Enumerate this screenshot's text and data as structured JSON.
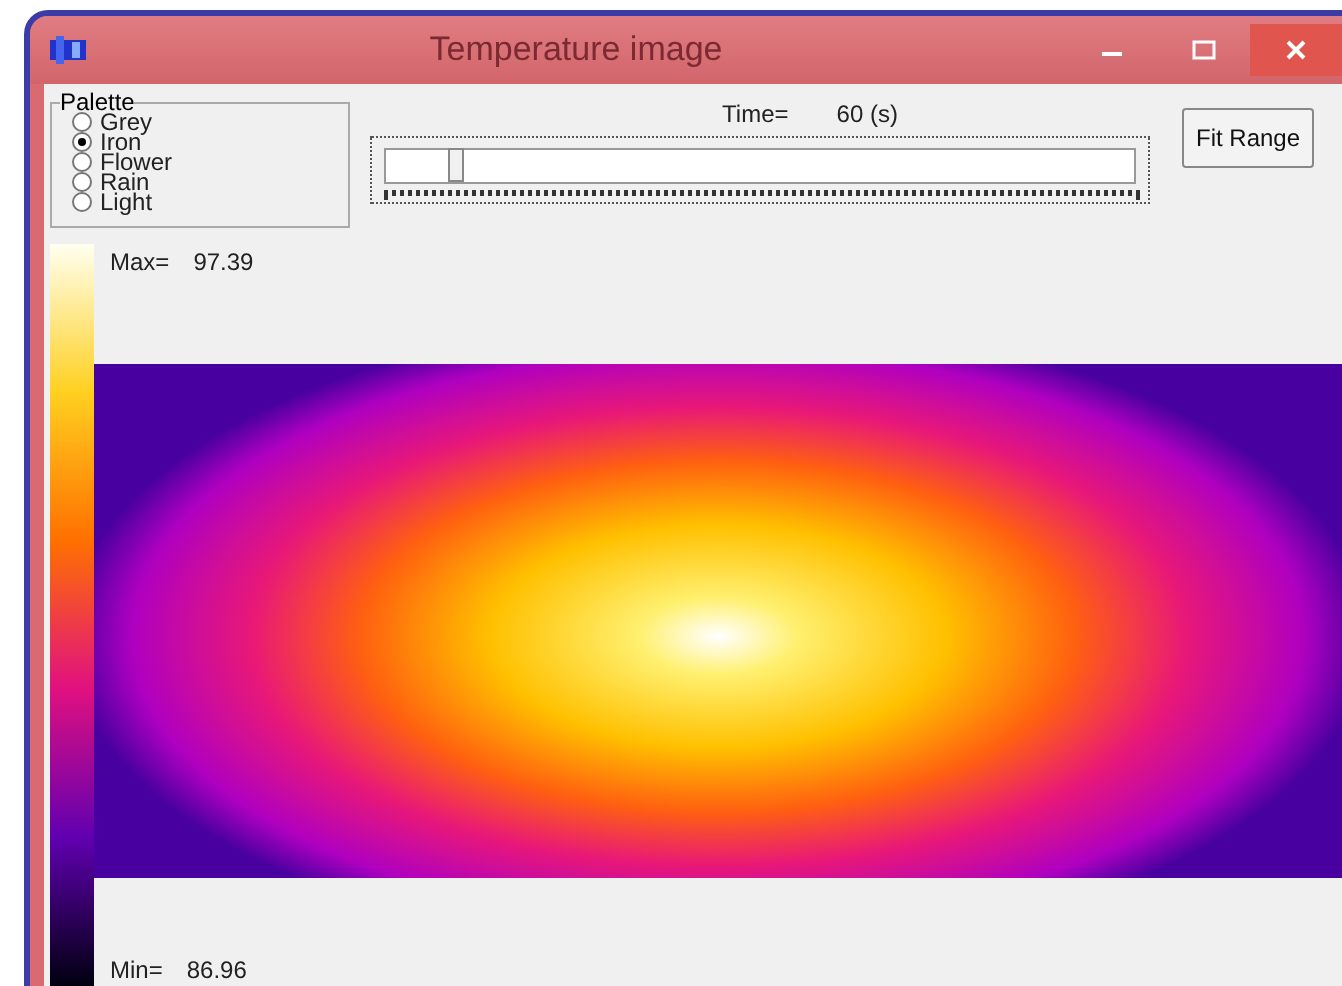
{
  "window": {
    "title": "Temperature image"
  },
  "palette": {
    "label": "Palette",
    "options": [
      {
        "label": "Grey",
        "selected": false
      },
      {
        "label": "Iron",
        "selected": true
      },
      {
        "label": "Flower",
        "selected": false
      },
      {
        "label": "Rain",
        "selected": false
      },
      {
        "label": "Light",
        "selected": false
      }
    ]
  },
  "time": {
    "label": "Time=",
    "value": "60 (s)",
    "slider": {
      "level": 0.05
    }
  },
  "buttons": [
    "Fit Range"
  ],
  "scale": {
    "max_label": "Max=",
    "max_value": "97.39",
    "min_label": "Min=",
    "min_value": "86.96"
  }
}
